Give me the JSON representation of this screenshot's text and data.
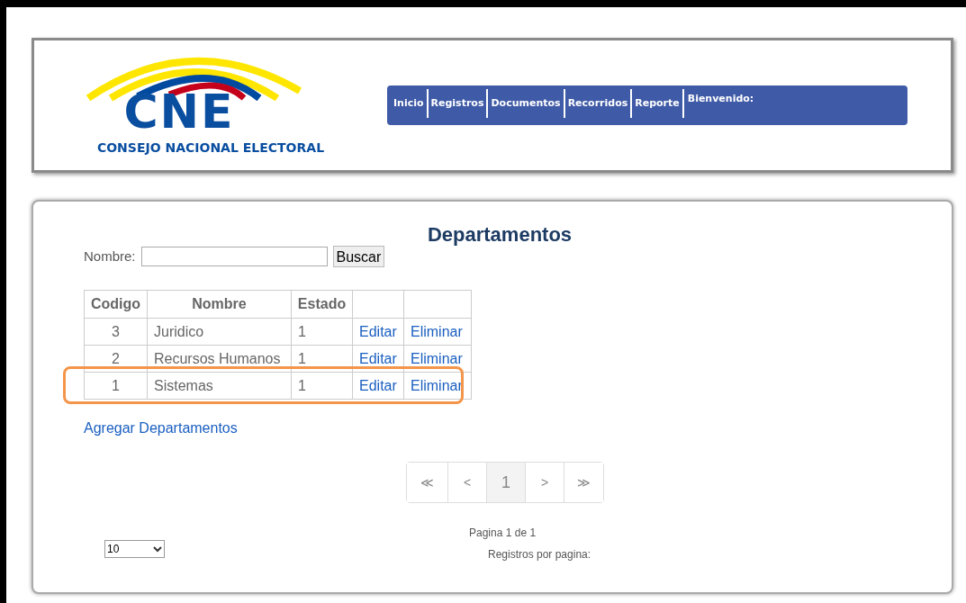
{
  "logo": {
    "mark": "CNE",
    "tagline": "CONSEJO NACIONAL ELECTORAL"
  },
  "nav": {
    "items": [
      "Inicio",
      "Registros",
      "Documentos",
      "Recorridos",
      "Reporte"
    ],
    "greeting": "Bienvenido:"
  },
  "title": "Departamentos",
  "search": {
    "label": "Nombre:",
    "button": "Buscar"
  },
  "table": {
    "columns": [
      "Codigo",
      "Nombre",
      "Estado",
      "",
      ""
    ],
    "rows": [
      {
        "cells": [
          "3",
          "Juridico",
          "1"
        ],
        "actions": [
          "Editar",
          "Eliminar"
        ],
        "highlighted": false
      },
      {
        "cells": [
          "2",
          "Recursos Humanos",
          "1"
        ],
        "actions": [
          "Editar",
          "Eliminar"
        ],
        "highlighted": false
      },
      {
        "cells": [
          "1",
          "Sistemas",
          "1"
        ],
        "actions": [
          "Editar",
          "Eliminar"
        ],
        "highlighted": true
      }
    ]
  },
  "add_link": "Agregar Departamentos",
  "pagination": [
    {
      "label": "≪",
      "selected": false
    },
    {
      "label": "<",
      "selected": false
    },
    {
      "label": "1",
      "selected": true
    },
    {
      "label": ">",
      "selected": false
    },
    {
      "label": "≫",
      "selected": false
    }
  ],
  "page_info": "Pagina 1 de 1",
  "page_size": {
    "value": "10",
    "label": "Registros por pagina:"
  }
}
